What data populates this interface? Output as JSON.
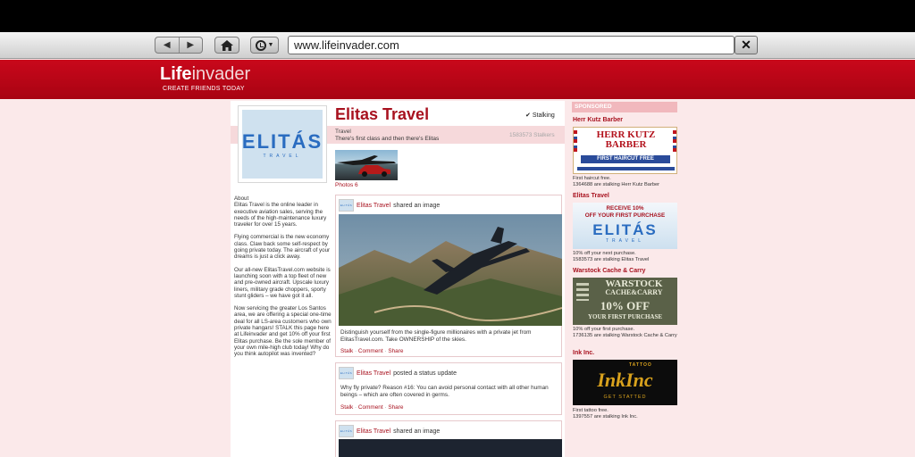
{
  "browser": {
    "url": "www.lifeinvader.com",
    "back_glyph": "◀",
    "forward_glyph": "▶",
    "close_glyph": "✕",
    "dropdown_glyph": "▼"
  },
  "site": {
    "logo_bold": "Life",
    "logo_light": "invader",
    "tagline": "CREATE FRIENDS TODAY",
    "accent_color": "#a8121f"
  },
  "profile": {
    "name": "Elitas Travel",
    "stalking_label": "Stalking",
    "stalking_glyph": "✔",
    "category": "Travel",
    "description": "There's first class and then there's Elitas",
    "stalkers": "1583573 Stalkers",
    "photos_label": "Photos 6",
    "logo_text": "ELITÁS",
    "logo_sub": "TRAVEL",
    "about_title": "About",
    "about_paragraphs": [
      "Elitas Travel is the online leader in executive aviation sales, serving the needs of the high-maintenance luxury traveler for over 15 years.",
      "Flying commercial is the new economy class. Claw back some self-respect by going private today. The aircraft of your dreams is just a click away.",
      "Our all-new ElitasTravel.com website is launching soon with a top fleet of new and pre-owned aircraft. Upscale luxury liners, military grade choppers, sporty stunt gliders – we have got it all.",
      "Now servicing the greater Los Santos area, we are offering a special one-time deal for all LS-area customers who own private hangars! STALK this page here at Lifeinvader and get 10% off your first Elitas purchase. Be the sole member of your own mile-high club today! Why do you think autopilot was invented?"
    ]
  },
  "posts": [
    {
      "author": "Elitas Travel",
      "action": "shared an image",
      "text": "Distinguish yourself from the single-figure millionaires with a private jet from ElitasTravel.com. Take OWNERSHIP of the skies.",
      "stalk": "Stalk",
      "comment": "Comment",
      "share": "Share"
    },
    {
      "author": "Elitas Travel",
      "action": "posted a status update",
      "text": "Why fly private? Reason #16: You can avoid personal contact with all other human beings – which are often covered in germs.",
      "stalk": "Stalk",
      "comment": "Comment",
      "share": "Share"
    },
    {
      "author": "Elitas Travel",
      "action": "shared an image"
    }
  ],
  "sidebar": {
    "sponsored_label": "SPONSORED",
    "ads": [
      {
        "title": "Herr Kutz Barber",
        "image_line1": "HERR KUTZ",
        "image_line2": "BARBER",
        "image_line3": "FIRST HAIRCUT FREE",
        "line1": "First haircut free.",
        "line2": "1364688 are stalking Herr Kutz Barber"
      },
      {
        "title": "Elitas Travel",
        "image_line1": "RECEIVE 10%",
        "image_line2": "OFF YOUR FIRST PURCHASE",
        "image_line3": "ELITÁS",
        "image_line4": "TRAVEL",
        "line1": "10% off your next purchase.",
        "line2": "1583573 are stalking Elitas Travel"
      },
      {
        "title": "Warstock Cache & Carry",
        "image_line1": "WARSTOCK",
        "image_line2": "CACHE&CARRY",
        "image_line3": "10% OFF",
        "image_line4": "YOUR FIRST PURCHASE",
        "line1": "10% off your first purchase.",
        "line2": "1736135 are stalking Warstock Cache & Carry"
      },
      {
        "title": "Ink Inc.",
        "image_line1": "InkInc",
        "image_line2": "TATTOO",
        "image_line3": "GET STATTED",
        "line1": "First tattoo free.",
        "line2": "1397557 are stalking Ink Inc."
      }
    ]
  }
}
